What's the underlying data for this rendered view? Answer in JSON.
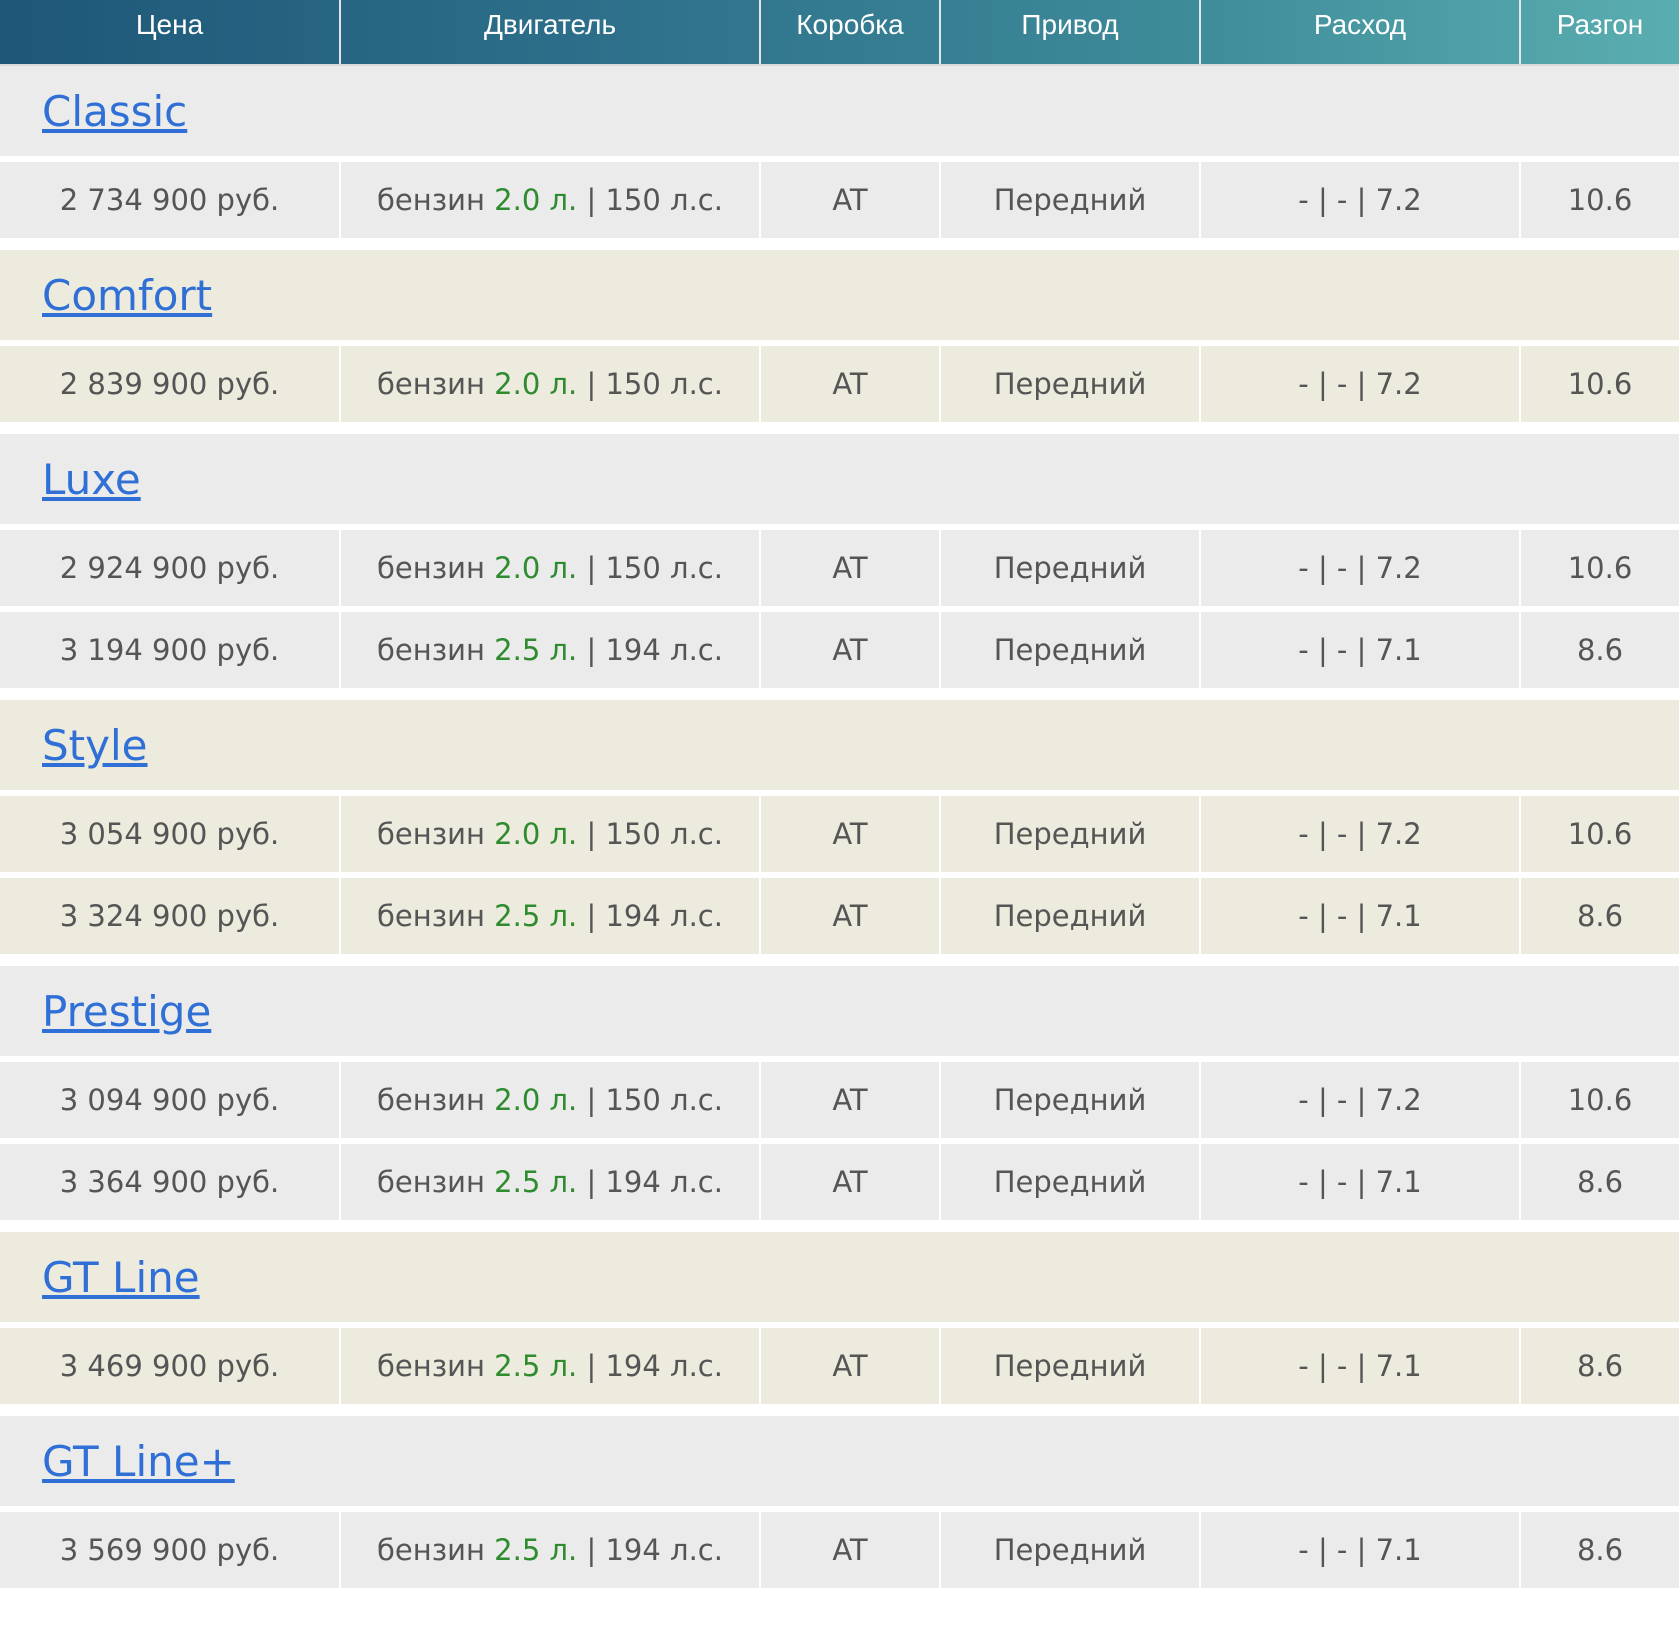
{
  "headers": {
    "price": "Цена",
    "engine": "Двигатель",
    "gearbox": "Коробка",
    "drive": "Привод",
    "consumption": "Расход",
    "acceleration": "Разгон"
  },
  "colors": {
    "header_start": "#1e5778",
    "header_end": "#5aaeb0",
    "link": "#2f6fd6",
    "volume_green": "#2e8b2e",
    "row_gray": "#ebebeb",
    "row_beige": "#ecebdd",
    "text": "#555555"
  },
  "trims": [
    {
      "name": "Classic",
      "rows": [
        {
          "price": "2 734 900 руб.",
          "fuel": "бензин",
          "volume": "2.0 л.",
          "power": "| 150 л.с.",
          "gearbox": "AT",
          "drive": "Передний",
          "consumption": "- | - | 7.2",
          "acceleration": "10.6"
        }
      ]
    },
    {
      "name": "Comfort",
      "rows": [
        {
          "price": "2 839 900 руб.",
          "fuel": "бензин",
          "volume": "2.0 л.",
          "power": "| 150 л.с.",
          "gearbox": "AT",
          "drive": "Передний",
          "consumption": "- | - | 7.2",
          "acceleration": "10.6"
        }
      ]
    },
    {
      "name": "Luxe",
      "rows": [
        {
          "price": "2 924 900 руб.",
          "fuel": "бензин",
          "volume": "2.0 л.",
          "power": "| 150 л.с.",
          "gearbox": "AT",
          "drive": "Передний",
          "consumption": "- | - | 7.2",
          "acceleration": "10.6"
        },
        {
          "price": "3 194 900 руб.",
          "fuel": "бензин",
          "volume": "2.5 л.",
          "power": "| 194 л.с.",
          "gearbox": "AT",
          "drive": "Передний",
          "consumption": "- | - | 7.1",
          "acceleration": "8.6"
        }
      ]
    },
    {
      "name": "Style",
      "rows": [
        {
          "price": "3 054 900 руб.",
          "fuel": "бензин",
          "volume": "2.0 л.",
          "power": "| 150 л.с.",
          "gearbox": "AT",
          "drive": "Передний",
          "consumption": "- | - | 7.2",
          "acceleration": "10.6"
        },
        {
          "price": "3 324 900 руб.",
          "fuel": "бензин",
          "volume": "2.5 л.",
          "power": "| 194 л.с.",
          "gearbox": "AT",
          "drive": "Передний",
          "consumption": "- | - | 7.1",
          "acceleration": "8.6"
        }
      ]
    },
    {
      "name": "Prestige",
      "rows": [
        {
          "price": "3 094 900 руб.",
          "fuel": "бензин",
          "volume": "2.0 л.",
          "power": "| 150 л.с.",
          "gearbox": "AT",
          "drive": "Передний",
          "consumption": "- | - | 7.2",
          "acceleration": "10.6"
        },
        {
          "price": "3 364 900 руб.",
          "fuel": "бензин",
          "volume": "2.5 л.",
          "power": "| 194 л.с.",
          "gearbox": "AT",
          "drive": "Передний",
          "consumption": "- | - | 7.1",
          "acceleration": "8.6"
        }
      ]
    },
    {
      "name": "GT Line",
      "rows": [
        {
          "price": "3 469 900 руб.",
          "fuel": "бензин",
          "volume": "2.5 л.",
          "power": "| 194 л.с.",
          "gearbox": "AT",
          "drive": "Передний",
          "consumption": "- | - | 7.1",
          "acceleration": "8.6"
        }
      ]
    },
    {
      "name": "GT Line+",
      "rows": [
        {
          "price": "3 569 900 руб.",
          "fuel": "бензин",
          "volume": "2.5 л.",
          "power": "| 194 л.с.",
          "gearbox": "AT",
          "drive": "Передний",
          "consumption": "- | - | 7.1",
          "acceleration": "8.6"
        }
      ]
    }
  ]
}
